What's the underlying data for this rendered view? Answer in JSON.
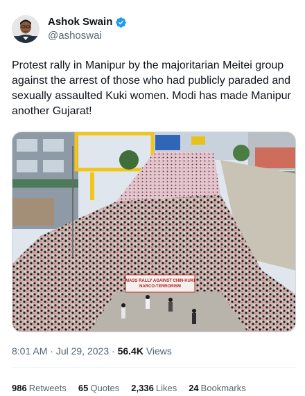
{
  "author": {
    "display_name": "Ashok Swain",
    "handle": "@ashoswai",
    "avatar_icon": "profile-photo",
    "verified_icon": "verified-badge-icon",
    "verified_color": "#1d9bf0"
  },
  "tweet": {
    "text": "Protest rally in Manipur by the majoritarian Meitei group against the arrest of those who had publicly paraded and sexually assaulted Kuki women. Modi has made Manipur another Gujarat!",
    "banner_text": "MASS RALLY AGAINST CHIN-KUKI NARCO-TERRORISM",
    "time": "8:01 AM",
    "separator": "·",
    "date": "Jul 29, 2023",
    "views_count": "56.4K",
    "views_label": "Views"
  },
  "stats": {
    "retweets_count": "986",
    "retweets_label": "Retweets",
    "quotes_count": "65",
    "quotes_label": "Quotes",
    "likes_count": "2,336",
    "likes_label": "Likes",
    "bookmarks_count": "24",
    "bookmarks_label": "Bookmarks"
  }
}
